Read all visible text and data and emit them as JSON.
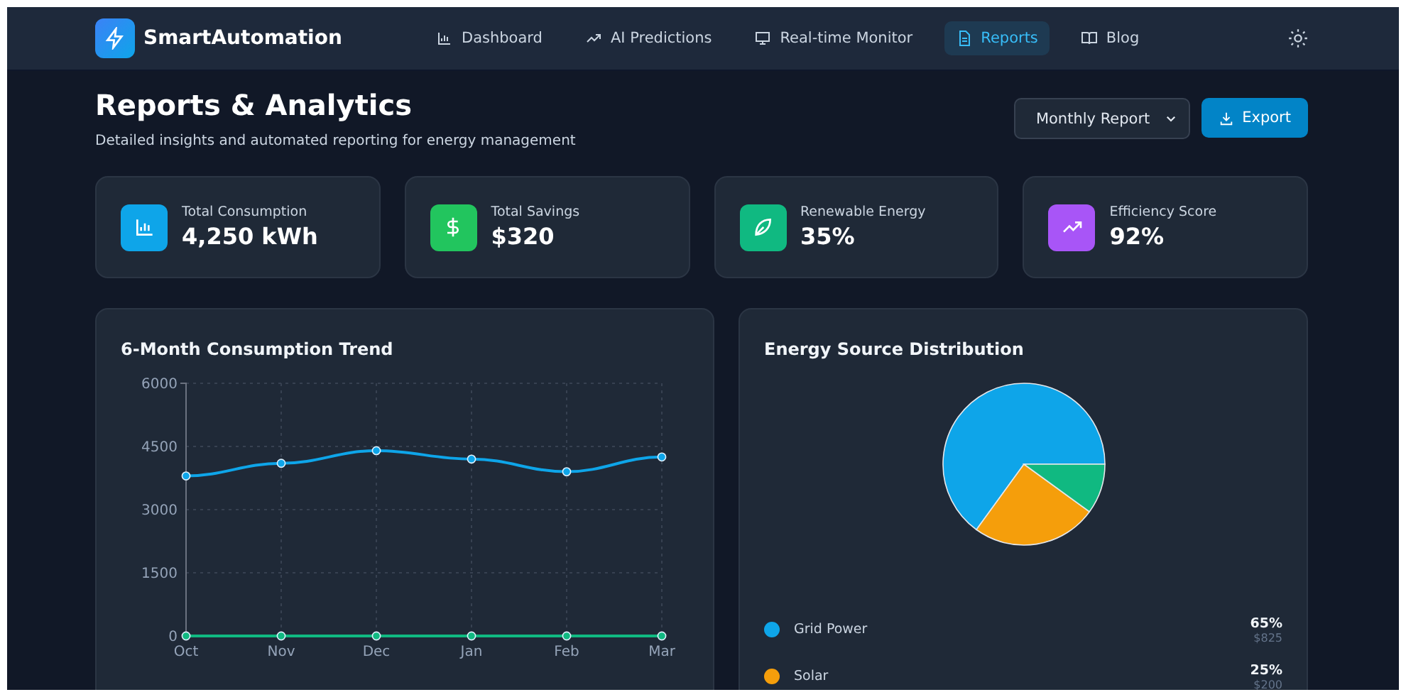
{
  "brand": {
    "name": "SmartAutomation"
  },
  "nav": [
    {
      "label": "Dashboard",
      "kind": "bars",
      "selected": false
    },
    {
      "label": "AI Predictions",
      "kind": "trend",
      "selected": false
    },
    {
      "label": "Real-time Monitor",
      "kind": "monitor",
      "selected": false
    },
    {
      "label": "Reports",
      "kind": "doc",
      "selected": true
    },
    {
      "label": "Blog",
      "kind": "book",
      "selected": false
    }
  ],
  "header": {
    "title": "Reports & Analytics",
    "subtitle": "Detailed insights and automated reporting for energy management",
    "report_select": "Monthly Report",
    "export_button": "Export"
  },
  "stats": [
    {
      "label": "Total Consumption",
      "value": "4,250 kWh",
      "kind": "bars",
      "color": "#0ea5e9"
    },
    {
      "label": "Total Savings",
      "value": "$320",
      "kind": "dollar",
      "color": "#22c55e"
    },
    {
      "label": "Renewable Energy",
      "value": "35%",
      "kind": "leaf",
      "color": "#10b981"
    },
    {
      "label": "Efficiency Score",
      "value": "92%",
      "kind": "trend",
      "color": "#a855f7"
    }
  ],
  "trend_card": {
    "title": "6-Month Consumption Trend",
    "chart_data": {
      "type": "line",
      "grid": true,
      "categories": [
        "Oct",
        "Nov",
        "Dec",
        "Jan",
        "Feb",
        "Mar"
      ],
      "ylim": [
        0,
        6000
      ],
      "yticks": [
        0,
        1500,
        3000,
        4500,
        6000
      ],
      "series": [
        {
          "color": "#0ea5e9",
          "marker": true,
          "values": [
            3800,
            4100,
            4400,
            4200,
            3900,
            4250
          ]
        },
        {
          "color": "#10b981",
          "marker": true,
          "values": [
            0,
            0,
            0,
            0,
            0,
            0
          ]
        }
      ]
    }
  },
  "source_card": {
    "title": "Energy Source Distribution",
    "chart_data": {
      "type": "pie",
      "series": [
        {
          "values": [
            65,
            25,
            10
          ],
          "colors": [
            "#0ea5e9",
            "#f59e0b",
            "#10b981"
          ]
        }
      ]
    },
    "legend": [
      {
        "label": "Grid Power",
        "percent": "65%",
        "cost": "$825",
        "color": "#0ea5e9"
      },
      {
        "label": "Solar",
        "percent": "25%",
        "cost": "$200",
        "color": "#f59e0b"
      }
    ]
  }
}
